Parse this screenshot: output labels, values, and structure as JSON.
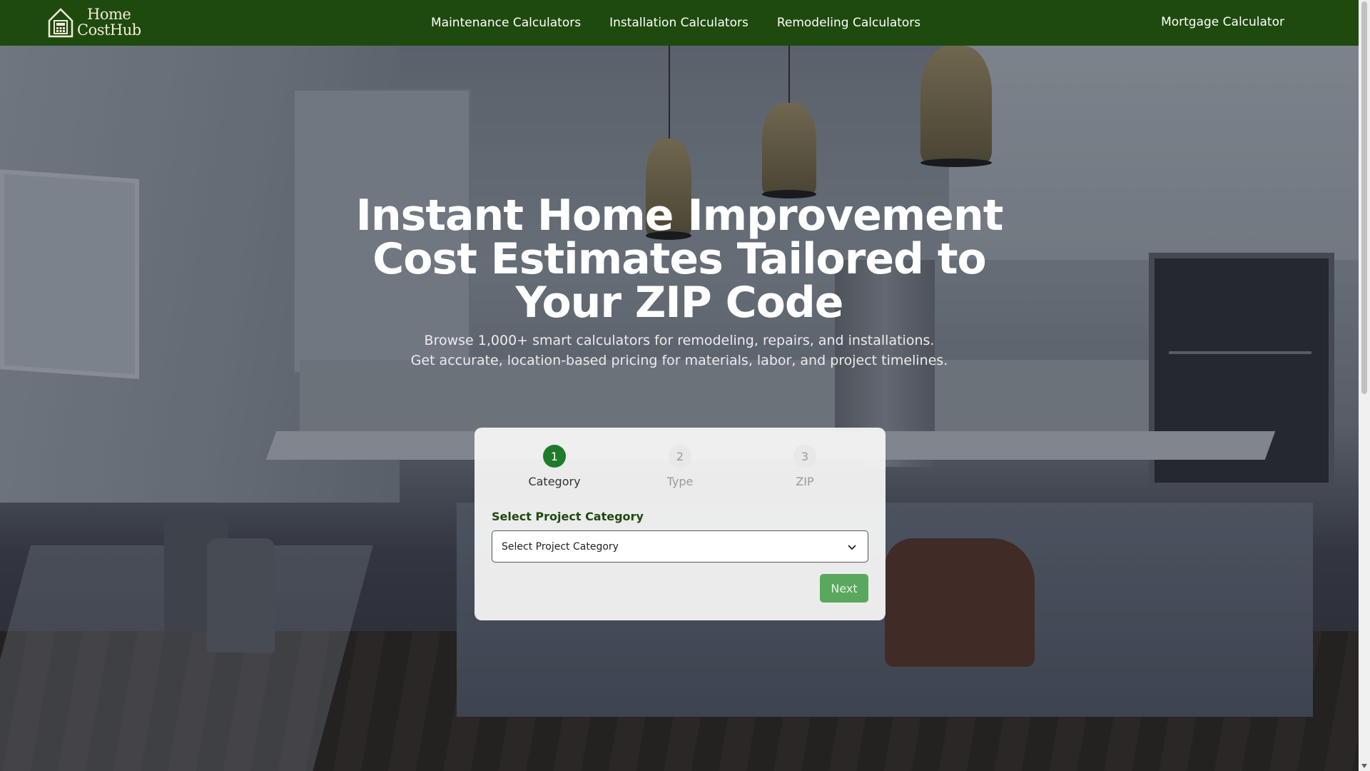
{
  "header": {
    "logo_line1": "Home",
    "logo_line2": "CostHub",
    "nav": [
      {
        "label": "Maintenance Calculators"
      },
      {
        "label": "Installation Calculators"
      },
      {
        "label": "Remodeling Calculators"
      }
    ],
    "mortgage_label": "Mortgage Calculator"
  },
  "hero": {
    "headline": "Instant Home Improvement Cost Estimates Tailored to Your ZIP Code",
    "subtext_line1": "Browse 1,000+ smart calculators for remodeling, repairs, and installations.",
    "subtext_line2": "Get accurate, location-based pricing for materials, labor, and project timelines."
  },
  "wizard": {
    "steps": [
      {
        "number": "1",
        "label": "Category",
        "state": "active"
      },
      {
        "number": "2",
        "label": "Type",
        "state": "inactive"
      },
      {
        "number": "3",
        "label": "ZIP",
        "state": "inactive"
      }
    ],
    "field_label": "Select Project Category",
    "select_value": "Select Project Category",
    "next_label": "Next"
  },
  "colors": {
    "header_bg": "#1e4a0e",
    "step_active": "#1f7a2c",
    "next_button": "#5aa85e"
  },
  "icons": {
    "logo": "house-calculator-icon",
    "select": "chevron-down-icon"
  }
}
